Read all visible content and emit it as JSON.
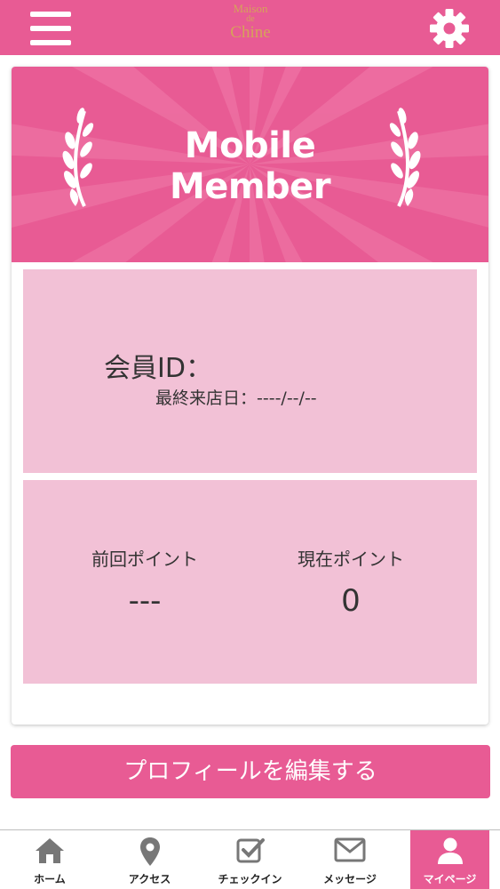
{
  "header": {
    "logo_line1": "Maison",
    "logo_line2": "de",
    "logo_line3": "Chine",
    "menu_icon": "hamburger-menu-icon",
    "settings_icon": "gear-icon"
  },
  "card": {
    "banner_title_line1": "Mobile",
    "banner_title_line2": "Member",
    "member_id_label": "会員ID：",
    "last_visit_label": "最終来店日：----/--/--",
    "previous_points_label": "前回ポイント",
    "previous_points_value": "---",
    "current_points_label": "現在ポイント",
    "current_points_value": "0"
  },
  "edit_profile_button": "プロフィールを編集する",
  "bottom_nav": {
    "items": [
      {
        "label": "ホーム",
        "icon": "home-icon"
      },
      {
        "label": "アクセス",
        "icon": "map-pin-icon"
      },
      {
        "label": "チェックイン",
        "icon": "checkbox-icon"
      },
      {
        "label": "メッセージ",
        "icon": "envelope-icon"
      },
      {
        "label": "マイページ",
        "icon": "user-icon"
      }
    ],
    "active_index": 4
  },
  "colors": {
    "brand_pink": "#e85b94",
    "panel_pink": "#f2c1d6",
    "logo_gold": "#d6a25a"
  }
}
